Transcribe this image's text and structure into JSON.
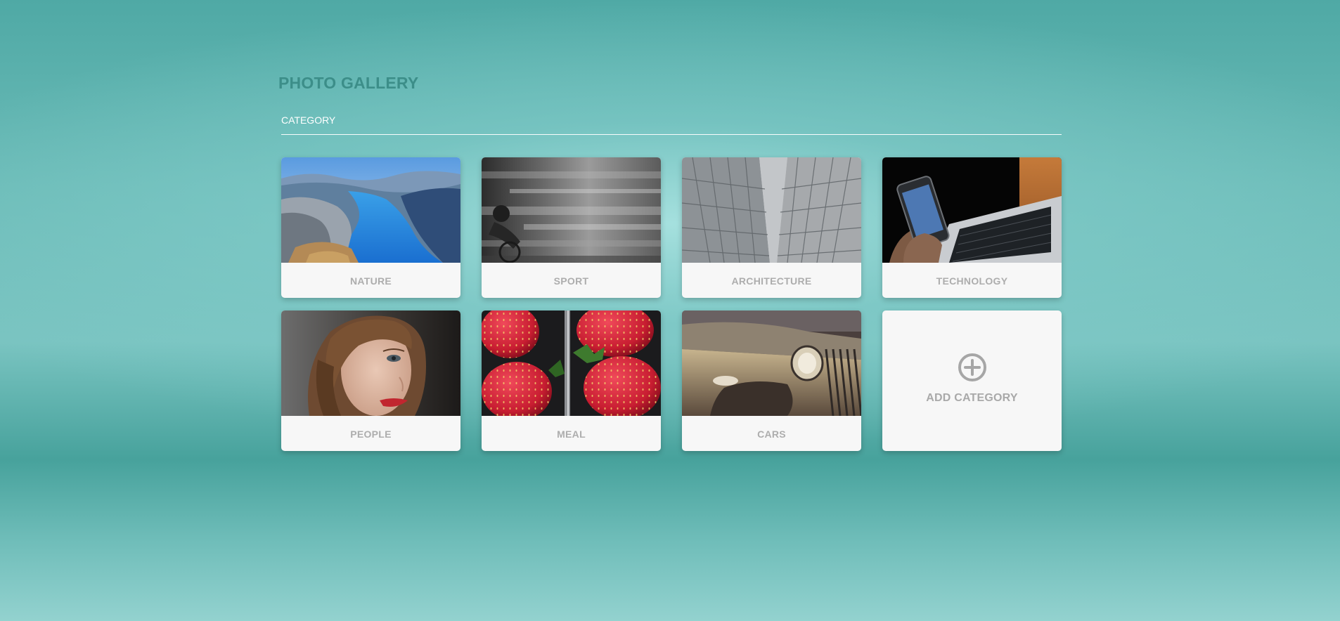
{
  "header": {
    "title": "PHOTO GALLERY"
  },
  "tabs": [
    {
      "label": "CATEGORY"
    }
  ],
  "categories": [
    {
      "label": "NATURE",
      "image": "fjord-landscape"
    },
    {
      "label": "SPORT",
      "image": "motion-blurred-cyclists"
    },
    {
      "label": "ARCHITECTURE",
      "image": "glass-skyscraper"
    },
    {
      "label": "TECHNOLOGY",
      "image": "smartphone-and-laptop"
    },
    {
      "label": "PEOPLE",
      "image": "woman-portrait"
    },
    {
      "label": "MEAL",
      "image": "strawberries"
    },
    {
      "label": "CARS",
      "image": "vintage-car"
    }
  ],
  "add_category": {
    "label": "ADD CATEGORY",
    "icon": "plus-circle-icon"
  },
  "colors": {
    "title": "#3c8e89",
    "card_label": "#adadad",
    "background_teal": "#4fa9a5"
  }
}
